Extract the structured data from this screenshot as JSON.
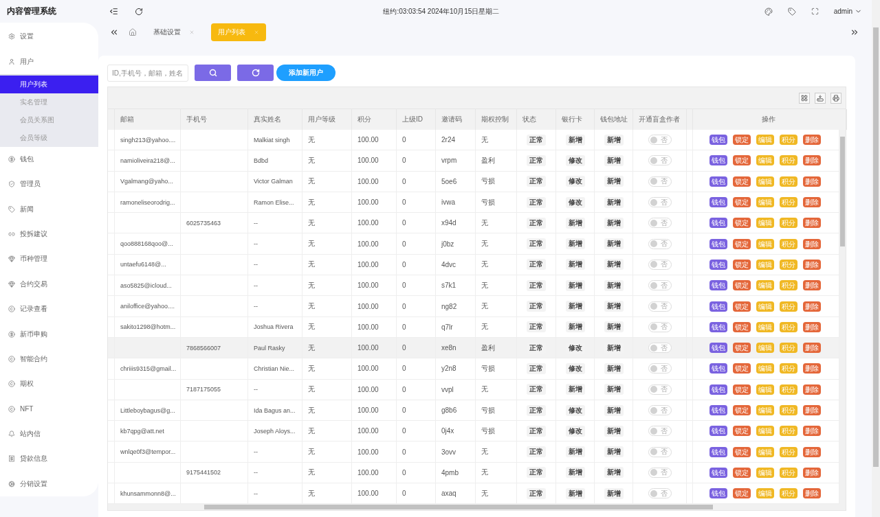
{
  "app_title": "内容管理系统",
  "header": {
    "clock": "纽约:03:03:54 2024年10月15日星期二",
    "user": "admin"
  },
  "sidebar": {
    "items": [
      {
        "label": "设置",
        "selected": false
      },
      {
        "label": "用户",
        "selected": false,
        "expanded": true,
        "children": [
          {
            "label": "用户列表",
            "selected": true
          },
          {
            "label": "实名管理",
            "selected": false
          },
          {
            "label": "会员关系图",
            "selected": false
          },
          {
            "label": "会员等级",
            "selected": false
          }
        ]
      },
      {
        "label": "钱包",
        "selected": false
      },
      {
        "label": "管理员",
        "selected": false
      },
      {
        "label": "新闻",
        "selected": false
      },
      {
        "label": "投拆建议",
        "selected": false
      },
      {
        "label": "币种管理",
        "selected": false
      },
      {
        "label": "合约交易",
        "selected": false
      },
      {
        "label": "记录查看",
        "selected": false
      },
      {
        "label": "新币申购",
        "selected": false
      },
      {
        "label": "智能合约",
        "selected": false
      },
      {
        "label": "期权",
        "selected": false
      },
      {
        "label": "NFT",
        "selected": false
      },
      {
        "label": "站内信",
        "selected": false
      },
      {
        "label": "贷款信息",
        "selected": false
      },
      {
        "label": "分销设置",
        "selected": false
      }
    ]
  },
  "tabs": [
    {
      "label": "基础设置",
      "selected": false
    },
    {
      "label": "用户列表",
      "selected": true
    }
  ],
  "toolbar": {
    "search_placeholder": "ID,手机号，邮箱，姓名",
    "add_button": "添加新用户"
  },
  "table": {
    "columns": [
      "邮箱",
      "手机号",
      "真实姓名",
      "用户等级",
      "积分",
      "上级ID",
      "邀请码",
      "期权控制",
      "状态",
      "银行卡",
      "钱包地址",
      "开通盲盒作者",
      "操作"
    ],
    "rows": [
      {
        "email": "singh213@yahoo....",
        "phone": "",
        "real_name": "Malkiat singh",
        "level": "无",
        "points": "100.00",
        "parent_id": "0",
        "invite_code": "2r24",
        "option_control": "无",
        "status": "正常",
        "bank_card": "新增",
        "wallet_address": "新增",
        "blind_box_author": {
          "label": "否",
          "on": false
        },
        "actions": [
          "钱包",
          "锁定",
          "编辑",
          "积分",
          "删除"
        ],
        "selected": false
      },
      {
        "email": "namioliveira218@...",
        "phone": "",
        "real_name": "Bdbd",
        "level": "无",
        "points": "100.00",
        "parent_id": "0",
        "invite_code": "vrpm",
        "option_control": "盈利",
        "status": "正常",
        "bank_card": "修改",
        "wallet_address": "新增",
        "blind_box_author": {
          "label": "否",
          "on": false
        },
        "actions": [
          "钱包",
          "锁定",
          "编辑",
          "积分",
          "删除"
        ],
        "selected": false
      },
      {
        "email": "Vgalmang@yaho...",
        "phone": "",
        "real_name": "Victor Galman",
        "level": "无",
        "points": "100.00",
        "parent_id": "0",
        "invite_code": "5oe6",
        "option_control": "亏损",
        "status": "正常",
        "bank_card": "修改",
        "wallet_address": "新增",
        "blind_box_author": {
          "label": "否",
          "on": false
        },
        "actions": [
          "钱包",
          "锁定",
          "编辑",
          "积分",
          "删除"
        ],
        "selected": false
      },
      {
        "email": "ramoneliseorodrig...",
        "phone": "",
        "real_name": "Ramon Elise...",
        "level": "无",
        "points": "100.00",
        "parent_id": "0",
        "invite_code": "ivwa",
        "option_control": "亏损",
        "status": "正常",
        "bank_card": "修改",
        "wallet_address": "新增",
        "blind_box_author": {
          "label": "否",
          "on": false
        },
        "actions": [
          "钱包",
          "锁定",
          "编辑",
          "积分",
          "删除"
        ],
        "selected": false
      },
      {
        "email": "",
        "phone": "6025735463",
        "real_name": "--",
        "level": "无",
        "points": "100.00",
        "parent_id": "0",
        "invite_code": "x94d",
        "option_control": "无",
        "status": "正常",
        "bank_card": "新增",
        "wallet_address": "新增",
        "blind_box_author": {
          "label": "否",
          "on": false
        },
        "actions": [
          "钱包",
          "锁定",
          "编辑",
          "积分",
          "删除"
        ],
        "selected": false
      },
      {
        "email": "qoo888168qoo@...",
        "phone": "",
        "real_name": "--",
        "level": "无",
        "points": "100.00",
        "parent_id": "0",
        "invite_code": "j0bz",
        "option_control": "无",
        "status": "正常",
        "bank_card": "新增",
        "wallet_address": "新增",
        "blind_box_author": {
          "label": "否",
          "on": false
        },
        "actions": [
          "钱包",
          "锁定",
          "编辑",
          "积分",
          "删除"
        ],
        "selected": false
      },
      {
        "email": "untaefu6148@...",
        "phone": "",
        "real_name": "--",
        "level": "无",
        "points": "100.00",
        "parent_id": "0",
        "invite_code": "4dvc",
        "option_control": "无",
        "status": "正常",
        "bank_card": "新增",
        "wallet_address": "新增",
        "blind_box_author": {
          "label": "否",
          "on": false
        },
        "actions": [
          "钱包",
          "锁定",
          "编辑",
          "积分",
          "删除"
        ],
        "selected": false
      },
      {
        "email": "aso5825@icloud...",
        "phone": "",
        "real_name": "--",
        "level": "无",
        "points": "100.00",
        "parent_id": "0",
        "invite_code": "s7k1",
        "option_control": "无",
        "status": "正常",
        "bank_card": "新增",
        "wallet_address": "新增",
        "blind_box_author": {
          "label": "否",
          "on": false
        },
        "actions": [
          "钱包",
          "锁定",
          "编辑",
          "积分",
          "删除"
        ],
        "selected": false
      },
      {
        "email": "aniloffice@yahoo....",
        "phone": "",
        "real_name": "--",
        "level": "无",
        "points": "100.00",
        "parent_id": "0",
        "invite_code": "ng82",
        "option_control": "无",
        "status": "正常",
        "bank_card": "新增",
        "wallet_address": "新增",
        "blind_box_author": {
          "label": "否",
          "on": false
        },
        "actions": [
          "钱包",
          "锁定",
          "编辑",
          "积分",
          "删除"
        ],
        "selected": false
      },
      {
        "email": "sakito1298@hotm...",
        "phone": "",
        "real_name": "Joshua Rivera",
        "level": "无",
        "points": "100.00",
        "parent_id": "0",
        "invite_code": "q7lr",
        "option_control": "无",
        "status": "正常",
        "bank_card": "新增",
        "wallet_address": "新增",
        "blind_box_author": {
          "label": "否",
          "on": false
        },
        "actions": [
          "钱包",
          "锁定",
          "编辑",
          "积分",
          "删除"
        ],
        "selected": false
      },
      {
        "email": "",
        "phone": "7868566007",
        "real_name": "Paul Rasky",
        "level": "无",
        "points": "100.00",
        "parent_id": "0",
        "invite_code": "xe8n",
        "option_control": "盈利",
        "status": "正常",
        "bank_card": "修改",
        "wallet_address": "新增",
        "blind_box_author": {
          "label": "否",
          "on": false
        },
        "actions": [
          "钱包",
          "锁定",
          "编辑",
          "积分",
          "删除"
        ],
        "selected": true
      },
      {
        "email": "chriiis9315@gmail...",
        "phone": "",
        "real_name": "Christian Nie...",
        "level": "无",
        "points": "100.00",
        "parent_id": "0",
        "invite_code": "y2n8",
        "option_control": "亏损",
        "status": "正常",
        "bank_card": "修改",
        "wallet_address": "新增",
        "blind_box_author": {
          "label": "否",
          "on": false
        },
        "actions": [
          "钱包",
          "锁定",
          "编辑",
          "积分",
          "删除"
        ],
        "selected": false
      },
      {
        "email": "",
        "phone": "7187175055",
        "real_name": "--",
        "level": "无",
        "points": "100.00",
        "parent_id": "0",
        "invite_code": "vvpl",
        "option_control": "无",
        "status": "正常",
        "bank_card": "新增",
        "wallet_address": "新增",
        "blind_box_author": {
          "label": "否",
          "on": false
        },
        "actions": [
          "钱包",
          "锁定",
          "编辑",
          "积分",
          "删除"
        ],
        "selected": false
      },
      {
        "email": "Littleboybagus@g...",
        "phone": "",
        "real_name": "Ida Bagus an...",
        "level": "无",
        "points": "100.00",
        "parent_id": "0",
        "invite_code": "g8b6",
        "option_control": "亏损",
        "status": "正常",
        "bank_card": "修改",
        "wallet_address": "新增",
        "blind_box_author": {
          "label": "否",
          "on": false
        },
        "actions": [
          "钱包",
          "锁定",
          "编辑",
          "积分",
          "删除"
        ],
        "selected": false
      },
      {
        "email": "kb7qpg@att.net",
        "phone": "",
        "real_name": "Joseph Aloys...",
        "level": "无",
        "points": "100.00",
        "parent_id": "0",
        "invite_code": "0j4x",
        "option_control": "亏损",
        "status": "正常",
        "bank_card": "修改",
        "wallet_address": "新增",
        "blind_box_author": {
          "label": "否",
          "on": false
        },
        "actions": [
          "钱包",
          "锁定",
          "编辑",
          "积分",
          "删除"
        ],
        "selected": false
      },
      {
        "email": "wnlqe0f3@tempor...",
        "phone": "",
        "real_name": "--",
        "level": "无",
        "points": "100.00",
        "parent_id": "0",
        "invite_code": "3ovv",
        "option_control": "无",
        "status": "正常",
        "bank_card": "新增",
        "wallet_address": "新增",
        "blind_box_author": {
          "label": "否",
          "on": false
        },
        "actions": [
          "钱包",
          "锁定",
          "编辑",
          "积分",
          "删除"
        ],
        "selected": false
      },
      {
        "email": "",
        "phone": "9175441502",
        "real_name": "--",
        "level": "无",
        "points": "100.00",
        "parent_id": "0",
        "invite_code": "4pmb",
        "option_control": "无",
        "status": "正常",
        "bank_card": "新增",
        "wallet_address": "新增",
        "blind_box_author": {
          "label": "否",
          "on": false
        },
        "actions": [
          "钱包",
          "锁定",
          "编辑",
          "积分",
          "删除"
        ],
        "selected": false
      },
      {
        "email": "khunsammonn8@...",
        "phone": "",
        "real_name": "--",
        "level": "无",
        "points": "100.00",
        "parent_id": "0",
        "invite_code": "axaq",
        "option_control": "无",
        "status": "正常",
        "bank_card": "新增",
        "wallet_address": "新增",
        "blind_box_author": {
          "label": "否",
          "on": false
        },
        "actions": [
          "钱包",
          "锁定",
          "编辑",
          "积分",
          "删除"
        ],
        "selected": false
      }
    ]
  }
}
